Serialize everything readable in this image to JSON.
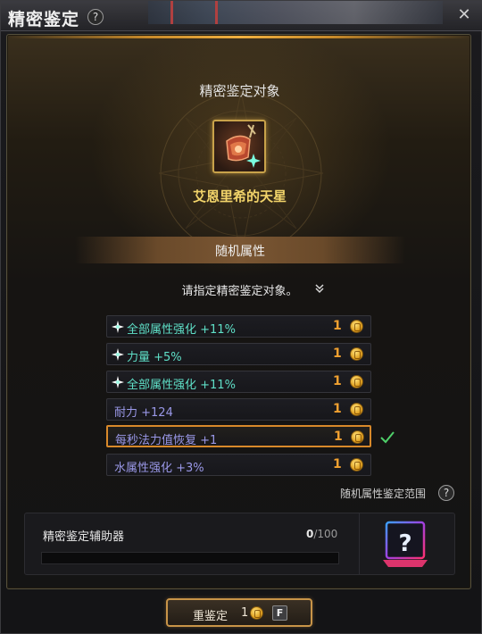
{
  "window": {
    "title": "精密鉴定",
    "help_label": "?",
    "close_label": "✕"
  },
  "target": {
    "heading": "精密鉴定对象",
    "item_name": "艾恩里希的天星",
    "item_icon": "necklace-icon"
  },
  "attributes": {
    "banner": "随机属性",
    "instruction": "请指定精密鉴定对象。",
    "rows": [
      {
        "label": "全部属性强化 +11%",
        "star": true,
        "cost": "1",
        "selected": false,
        "color": "#5fe0c8"
      },
      {
        "label": "力量 +5%",
        "star": true,
        "cost": "1",
        "selected": false,
        "color": "#5fe0c8"
      },
      {
        "label": "全部属性强化 +11%",
        "star": true,
        "cost": "1",
        "selected": false,
        "color": "#5fe0c8"
      },
      {
        "label": "耐力 +124",
        "star": false,
        "cost": "1",
        "selected": false,
        "color": "#9a98e8"
      },
      {
        "label": "每秒法力值恢复 +1",
        "star": false,
        "cost": "1",
        "selected": true,
        "color": "#9a98e8"
      },
      {
        "label": "水属性强化 +3%",
        "star": false,
        "cost": "1",
        "selected": false,
        "color": "#9a98e8"
      }
    ],
    "range_label": "随机属性鉴定范围",
    "range_help": "?"
  },
  "assistant": {
    "label": "精密鉴定辅助器",
    "current": "0",
    "max": "/100",
    "progress": 0
  },
  "reroll": {
    "label": "重鉴定",
    "cost": "1",
    "hotkey": "F"
  },
  "colors": {
    "accent": "#d8892a",
    "gold_text": "#f2d46a",
    "cost": "#f0a030",
    "check": "#4fd06a"
  }
}
